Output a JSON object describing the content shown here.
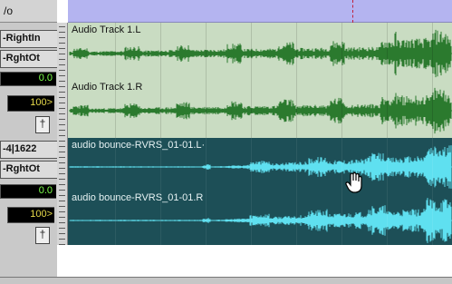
{
  "header": {
    "left_label": "/o"
  },
  "tracks": [
    {
      "name": "Audio Track 1.L",
      "style": "light",
      "waveform_color": "#2b7a2e",
      "selected": false
    },
    {
      "name": "Audio Track 1.R",
      "style": "light",
      "waveform_color": "#2b7a2e",
      "selected": false
    },
    {
      "name": "audio bounce-RVRS_01-01.L·",
      "style": "dark",
      "waveform_color": "#5fe0f0",
      "selected": true
    },
    {
      "name": "audio bounce-RVRS_01-01.R",
      "style": "dark",
      "waveform_color": "#5fe0f0",
      "selected": true
    }
  ],
  "mixer": {
    "track1": {
      "input": "-RightIn",
      "output": "-RghtOt",
      "volume": "0.0",
      "pan": "100>",
      "rec_symbol": "†"
    },
    "track2": {
      "input": "-4|1622",
      "output": "-RghtOt",
      "volume": "0.0",
      "pan": "100>",
      "rec_symbol": "†"
    }
  },
  "cursor": {
    "icon": "grabber-hand-icon"
  },
  "colors": {
    "timeline": "#b4b4f0",
    "light_track": "#c9dcc2",
    "dark_track": "#1d4f57",
    "playhead": "#c0203a"
  }
}
